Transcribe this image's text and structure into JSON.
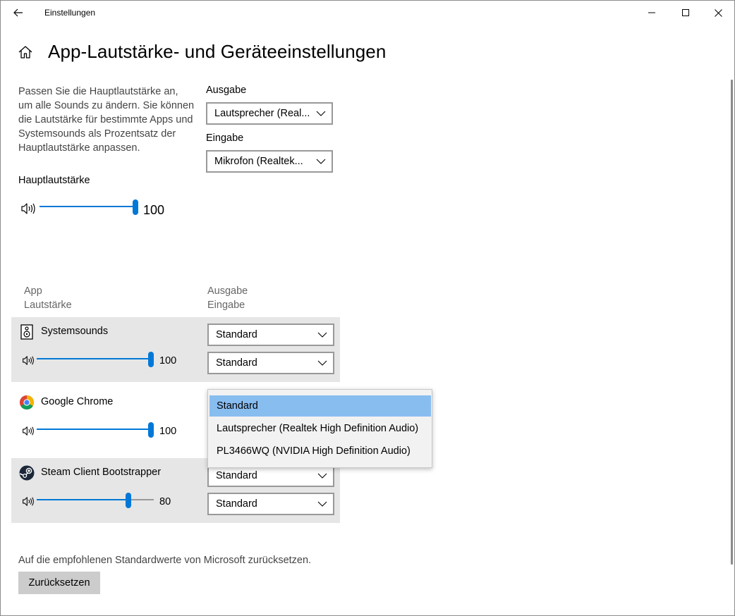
{
  "window": {
    "title": "Einstellungen",
    "back_icon": "arrow-left-icon",
    "minimize_icon": "minimize-icon",
    "maximize_icon": "maximize-icon",
    "close_icon": "close-icon"
  },
  "page": {
    "title": "App-Lautstärke- und Geräteeinstellungen",
    "home_icon": "home-icon",
    "description": "Passen Sie die Hauptlautstärke an, um alle Sounds zu ändern. Sie können die Lautstärke für bestimmte Apps und Systemsounds als Prozentsatz der Hauptlautstärke anpassen."
  },
  "master": {
    "label": "Hauptlautstärke",
    "value": "100",
    "level": 100
  },
  "devices": {
    "output_label": "Ausgabe",
    "output_value": "Lautsprecher (Real...",
    "input_label": "Eingabe",
    "input_value": "Mikrofon (Realtek..."
  },
  "columns": {
    "app": "App",
    "volume": "Lautstärke",
    "output": "Ausgabe",
    "input": "Eingabe"
  },
  "apps": [
    {
      "name": "Systemsounds",
      "icon": "speaker-icon",
      "volume": "100",
      "level": 100,
      "output": "Standard",
      "input": "Standard"
    },
    {
      "name": "Google Chrome",
      "icon": "chrome-icon",
      "volume": "100",
      "level": 100,
      "output": "Standard",
      "input": "Standard"
    },
    {
      "name": "Steam Client Bootstrapper",
      "icon": "steam-icon",
      "volume": "80",
      "level": 80,
      "output": "Standard",
      "input": "Standard"
    }
  ],
  "dropdown_popup": {
    "options": [
      "Standard",
      "Lautsprecher (Realtek High Definition Audio)",
      "PL3466WQ (NVIDIA High Definition Audio)"
    ],
    "selected": "Standard"
  },
  "reset": {
    "description": "Auf die empfohlenen Standardwerte von Microsoft zurücksetzen.",
    "button_label": "Zurücksetzen"
  },
  "colors": {
    "accent": "#0078d7",
    "selected_option": "#88bdf0",
    "row_highlight": "#e6e6e6"
  }
}
